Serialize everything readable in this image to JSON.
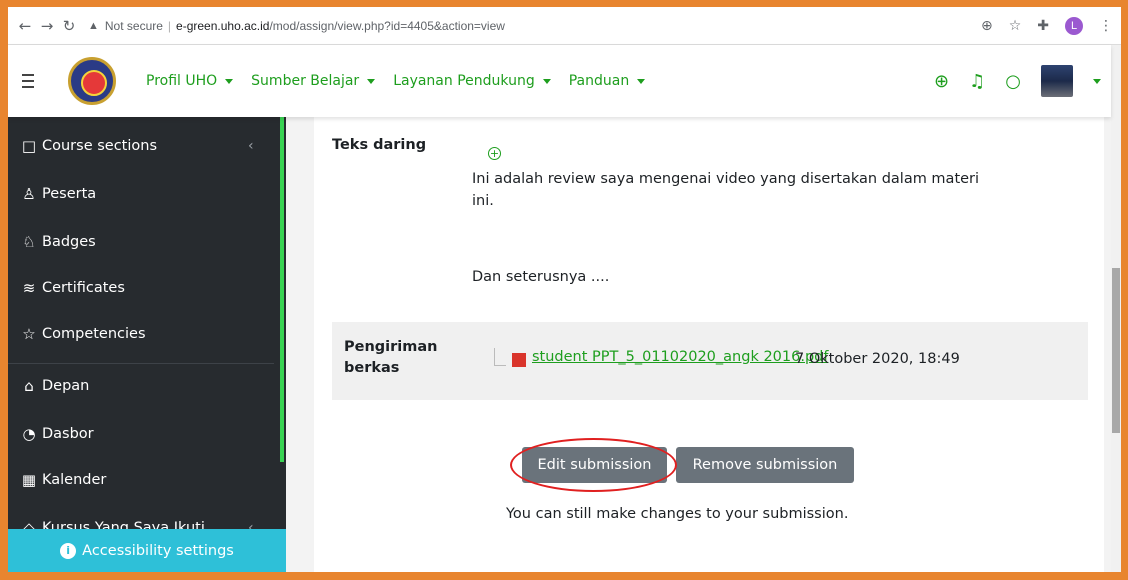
{
  "browser": {
    "not_secure": "Not secure",
    "separator": "|",
    "url_host": "e-green.uho.ac.id",
    "url_path": "/mod/assign/view.php?id=4405&action=view",
    "profile_letter": "L"
  },
  "navbar": {
    "menu": [
      {
        "label": "Profil UHO"
      },
      {
        "label": "Sumber Belajar"
      },
      {
        "label": "Layanan Pendukung"
      },
      {
        "label": "Panduan"
      }
    ]
  },
  "sidebar": {
    "items": [
      {
        "label": "Course sections",
        "icon": "folder-icon"
      },
      {
        "label": "Peserta",
        "icon": "users-icon"
      },
      {
        "label": "Badges",
        "icon": "badge-icon"
      },
      {
        "label": "Certificates",
        "icon": "layers-icon"
      },
      {
        "label": "Competencies",
        "icon": "star-icon"
      },
      {
        "label": "Depan",
        "icon": "home-icon"
      },
      {
        "label": "Dasbor",
        "icon": "dashboard-icon"
      },
      {
        "label": "Kalender",
        "icon": "calendar-icon"
      },
      {
        "label": "Kursus Yang Saya Ikuti",
        "icon": "graduation-cap-icon"
      }
    ],
    "accessibility": "Accessibility settings"
  },
  "submission": {
    "online_text_label": "Teks daring",
    "online_text_line1": "Ini adalah review saya mengenai video yang disertakan dalam materi",
    "online_text_line2": "ini.",
    "online_text_line3": "Dan seterusnya ....",
    "file_label_line1": "Pengiriman",
    "file_label_line2": "berkas",
    "file_name": "student PPT_5_01102020_angk 2016.pdf",
    "file_date": "7 Oktober 2020, 18:49",
    "edit_button": "Edit submission",
    "remove_button": "Remove submission",
    "note": "You can still make changes to your submission."
  },
  "colors": {
    "accent": "#1e9e1e",
    "frame": "#e8852f",
    "sidebar_bg": "#272b2f",
    "accessibility_bg": "#2ec0d8",
    "button_bg": "#6a737b",
    "highlight": "#e02020"
  }
}
